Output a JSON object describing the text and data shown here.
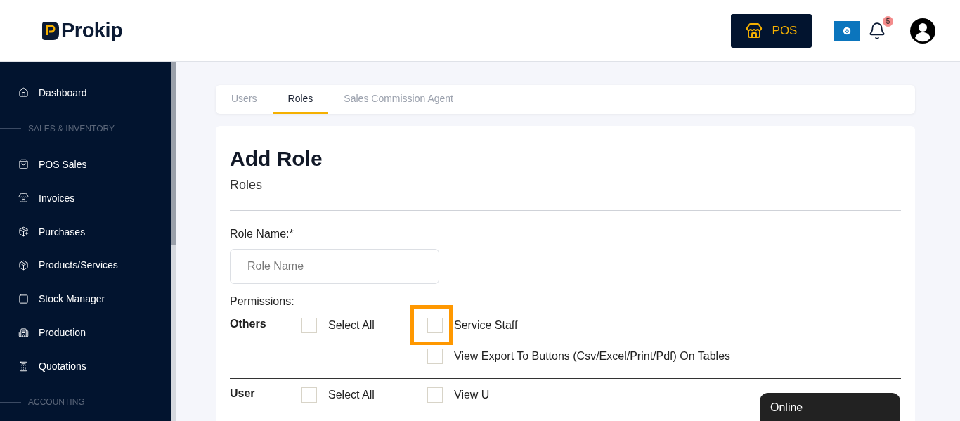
{
  "header": {
    "logo": "Prokip",
    "pos_button": "POS",
    "notification_count": "5"
  },
  "sidebar": {
    "items": [
      {
        "kind": "link",
        "label": "Dashboard"
      },
      {
        "kind": "section",
        "label": "SALES & INVENTORY"
      },
      {
        "kind": "link",
        "label": "POS Sales"
      },
      {
        "kind": "link",
        "label": "Invoices"
      },
      {
        "kind": "link",
        "label": "Purchases"
      },
      {
        "kind": "link",
        "label": "Products/Services"
      },
      {
        "kind": "link",
        "label": "Stock Manager"
      },
      {
        "kind": "link",
        "label": "Production"
      },
      {
        "kind": "link",
        "label": "Quotations"
      },
      {
        "kind": "section",
        "label": "ACCOUNTING"
      }
    ]
  },
  "tabs": [
    {
      "label": "Users",
      "selected": false
    },
    {
      "label": "Roles",
      "selected": true
    },
    {
      "label": "Sales Commission Agent",
      "selected": false
    }
  ],
  "form": {
    "title": "Add Role",
    "subtitle": "Roles",
    "role_name_label": "Role Name:*",
    "role_name_placeholder": "Role Name",
    "permissions_label": "Permissions:",
    "groups": [
      {
        "name": "Others",
        "select_all": {
          "label": "Select All",
          "checked": false
        },
        "permissions": [
          {
            "label": "Service Staff",
            "checked": false,
            "highlighted": true
          },
          {
            "label": "View Export To Buttons (Csv/Excel/Print/Pdf) On Tables",
            "checked": false,
            "highlighted": false
          }
        ]
      },
      {
        "name": "User",
        "select_all": {
          "label": "Select All",
          "checked": false
        },
        "permissions": [
          {
            "label": "View U",
            "checked": false,
            "highlighted": false
          }
        ]
      }
    ]
  },
  "chat_widget": {
    "status": "Online"
  }
}
